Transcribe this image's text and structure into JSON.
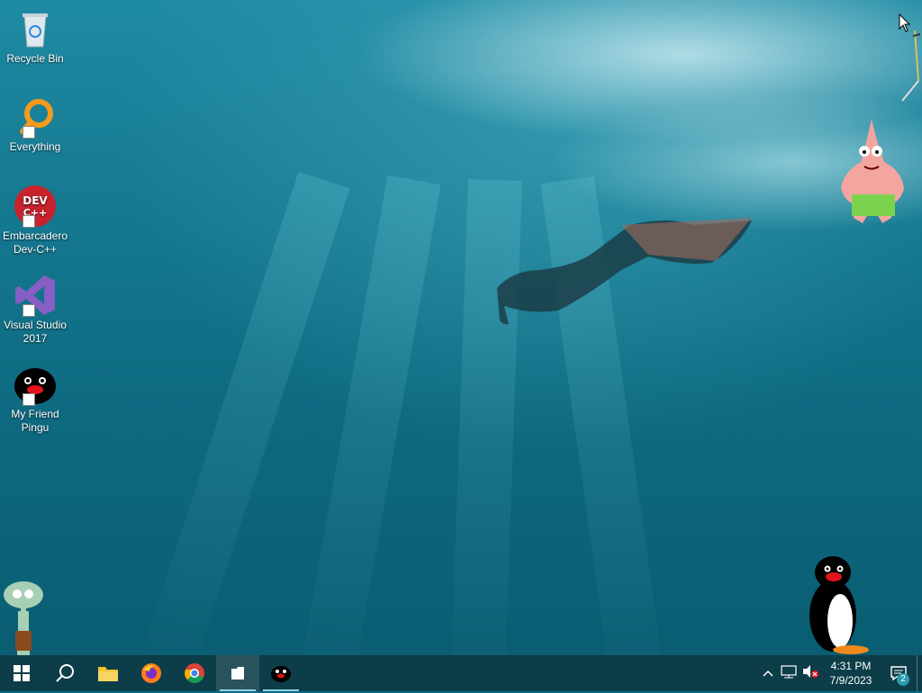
{
  "desktop": {
    "icons": [
      {
        "label": "Recycle Bin",
        "icon": "recycle-bin-icon"
      },
      {
        "label": "Everything",
        "icon": "everything-search-icon"
      },
      {
        "label": "Embarcadero Dev-C++",
        "icon": "dev-cpp-icon",
        "badge": "DEV C++"
      },
      {
        "label": "Visual Studio 2017",
        "icon": "visual-studio-icon"
      },
      {
        "label": "My Friend Pingu",
        "icon": "pingu-icon"
      }
    ]
  },
  "taskbar": {
    "start": "windows-start-icon",
    "search": "search-icon",
    "apps": [
      {
        "name": "File Explorer",
        "icon": "folder-icon"
      },
      {
        "name": "Firefox",
        "icon": "firefox-icon"
      },
      {
        "name": "Google Chrome",
        "icon": "chrome-icon"
      },
      {
        "name": "File",
        "icon": "file-icon",
        "active": true
      },
      {
        "name": "My Friend Pingu",
        "icon": "pingu-icon",
        "running": true
      }
    ]
  },
  "tray": {
    "time": "4:31 PM",
    "date": "7/9/2023",
    "notification_count": "2",
    "icons": [
      "chevron-up-icon",
      "network-icon",
      "volume-muted-icon"
    ]
  },
  "colors": {
    "taskbar": "#0c3d48",
    "accent": "#0e6b82"
  }
}
